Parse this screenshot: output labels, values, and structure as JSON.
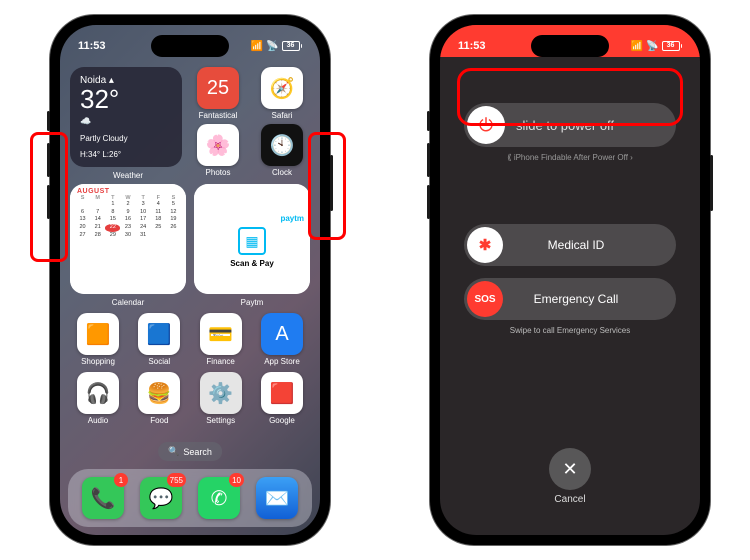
{
  "statusbar": {
    "time": "11:53",
    "signal": "••••",
    "wifi": "wifi",
    "battery_pct": "36"
  },
  "weather": {
    "city": "Noida",
    "temp": "32°",
    "cond_icon": "☁️",
    "cond": "Partly Cloudy",
    "hl": "H:34° L:26°",
    "label": "Weather"
  },
  "apps_row1": {
    "fantastical": {
      "icon": "📅",
      "label": "Fantastical",
      "bg": "#e74c3c"
    },
    "safari": {
      "icon": "🧭",
      "label": "Safari",
      "bg": "#fff"
    },
    "photos": {
      "icon": "🌸",
      "label": "Photos",
      "bg": "#fff"
    },
    "clock": {
      "icon": "🕙",
      "label": "Clock",
      "bg": "#111"
    }
  },
  "calendar": {
    "month": "AUGUST",
    "dow": [
      "S",
      "M",
      "T",
      "W",
      "T",
      "F",
      "S"
    ],
    "leading_blanks": 2,
    "days": 31,
    "today": 22,
    "label": "Calendar"
  },
  "paytm": {
    "brand": "paytm",
    "action": "Scan & Pay",
    "label": "Paytm"
  },
  "apps_row3": [
    {
      "icon": "🟧",
      "label": "Shopping"
    },
    {
      "icon": "🟦",
      "label": "Social"
    },
    {
      "icon": "💳",
      "label": "Finance"
    },
    {
      "icon": "A",
      "label": "App Store",
      "bg": "#1f7cf1",
      "fg": "#fff"
    }
  ],
  "apps_row4": [
    {
      "icon": "🎧",
      "label": "Audio"
    },
    {
      "icon": "🍔",
      "label": "Food"
    },
    {
      "icon": "⚙️",
      "label": "Settings",
      "bg": "#e5e5e5"
    },
    {
      "icon": "🟥",
      "label": "Google"
    }
  ],
  "search": {
    "label": "Search"
  },
  "dock": {
    "phone": {
      "badge": "1",
      "bg": "#34c759"
    },
    "messages": {
      "badge": "755",
      "bg": "#34c759"
    },
    "whatsapp": {
      "badge": "10",
      "bg": "#25d366"
    },
    "mail": {
      "bg": "#1f7cf1"
    }
  },
  "poweroff": {
    "slide": "slide to power off",
    "findable": "iPhone Findable After Power Off",
    "medical": "Medical ID",
    "sos_badge": "SOS",
    "emergency": "Emergency Call",
    "swipe": "Swipe to call Emergency Services",
    "cancel": "Cancel"
  }
}
